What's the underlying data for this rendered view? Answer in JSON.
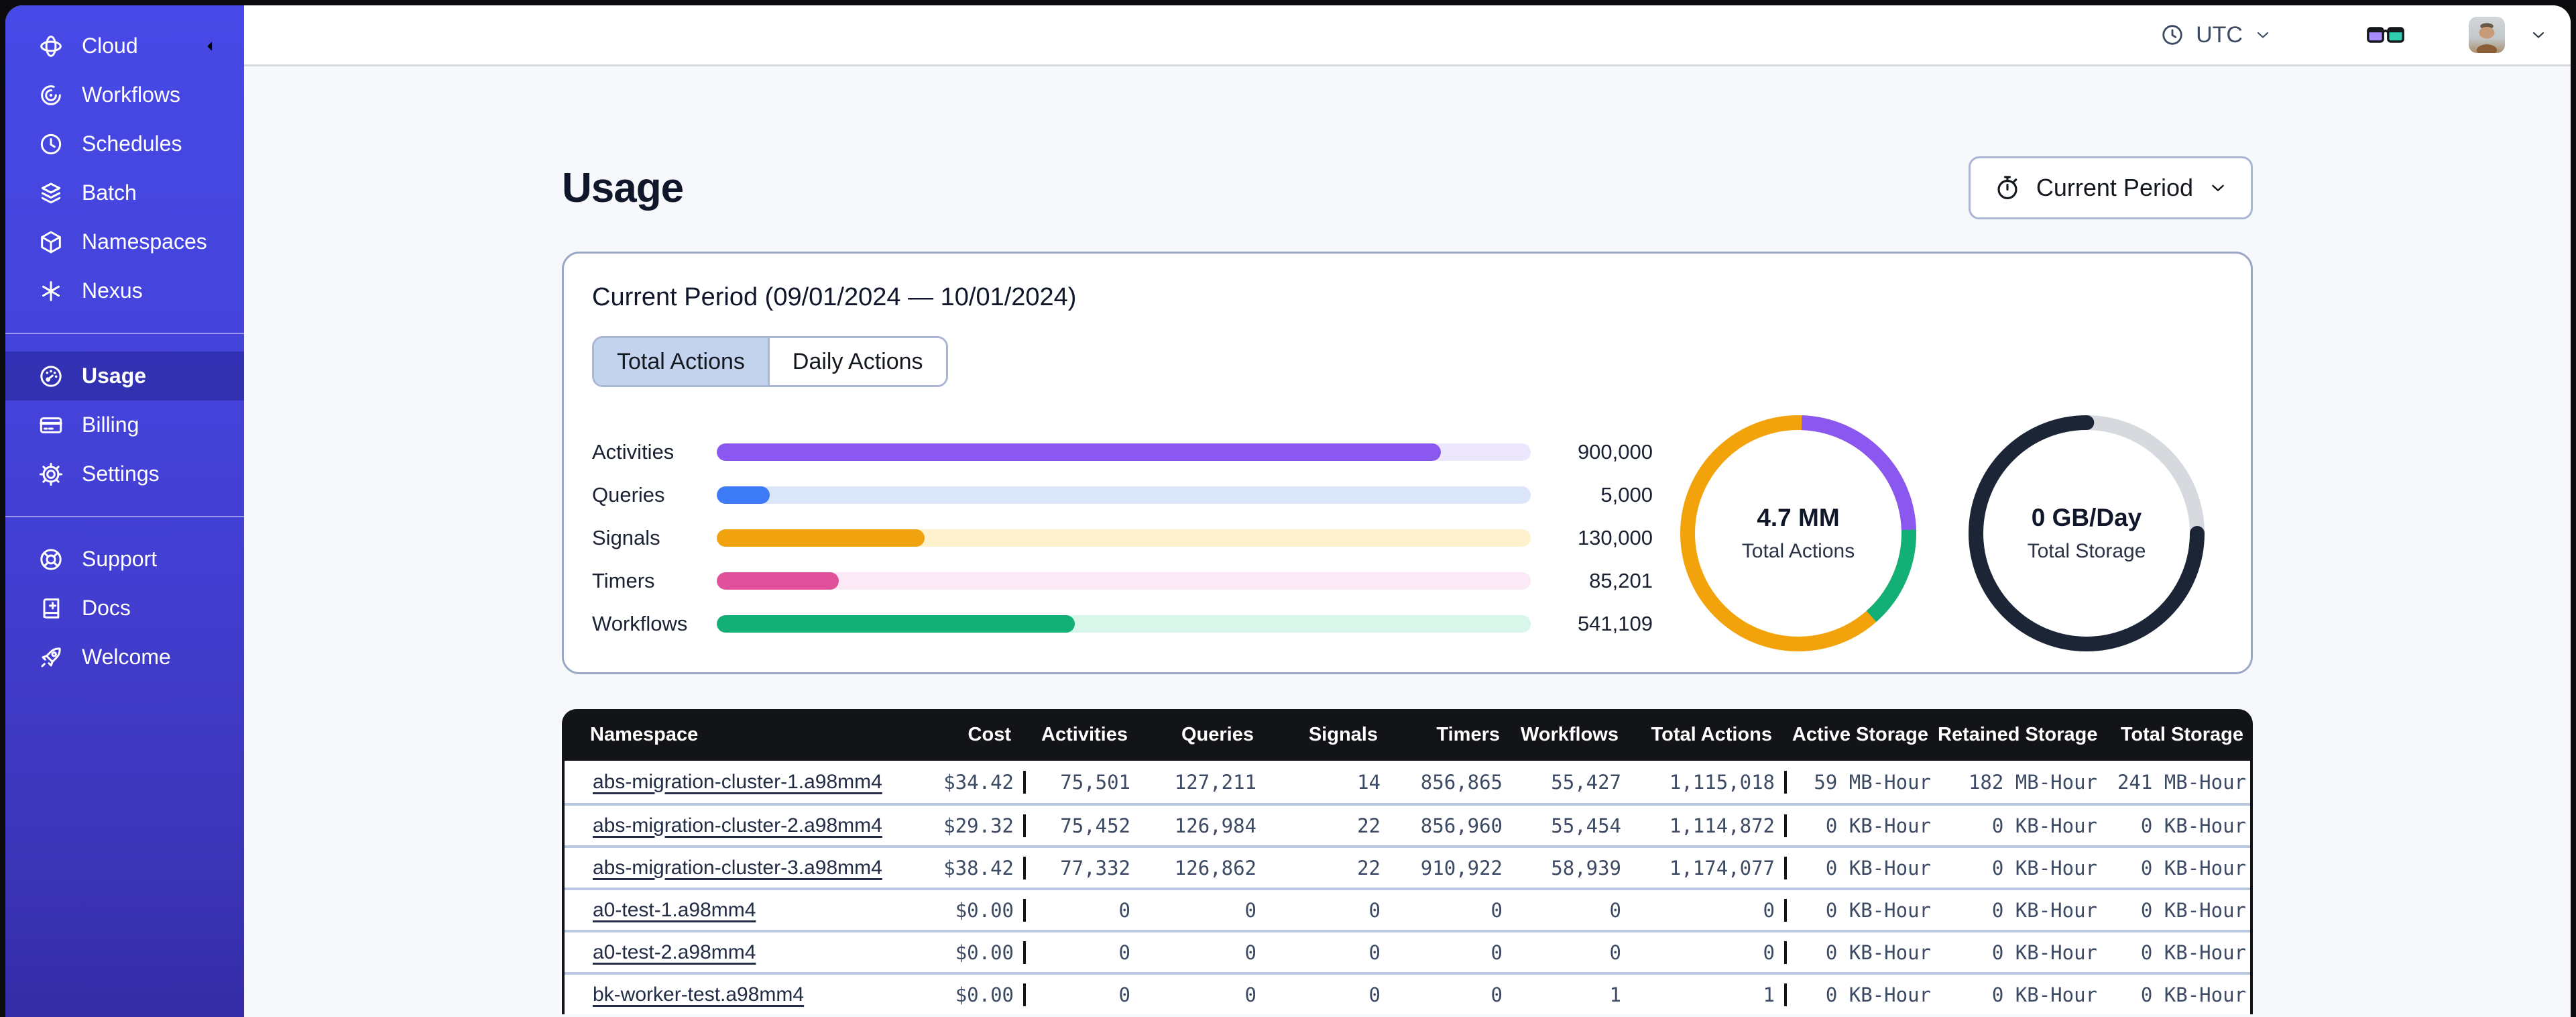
{
  "sidebar": {
    "brand": {
      "label": "Cloud",
      "icon": "temporal-logo-icon"
    },
    "groups": [
      {
        "items": [
          {
            "label": "Workflows",
            "icon": "workflows-icon"
          },
          {
            "label": "Schedules",
            "icon": "schedules-icon"
          },
          {
            "label": "Batch",
            "icon": "batch-icon"
          },
          {
            "label": "Namespaces",
            "icon": "namespaces-icon"
          },
          {
            "label": "Nexus",
            "icon": "nexus-icon"
          }
        ]
      },
      {
        "items": [
          {
            "label": "Usage",
            "icon": "usage-gauge-icon",
            "active": true
          },
          {
            "label": "Billing",
            "icon": "billing-card-icon"
          },
          {
            "label": "Settings",
            "icon": "settings-gear-icon"
          }
        ]
      },
      {
        "items": [
          {
            "label": "Support",
            "icon": "support-lifebuoy-icon"
          },
          {
            "label": "Docs",
            "icon": "docs-book-icon"
          },
          {
            "label": "Welcome",
            "icon": "welcome-rocket-icon"
          }
        ]
      }
    ]
  },
  "topbar": {
    "timezone": "UTC"
  },
  "main": {
    "title": "Usage",
    "period_button": "Current Period"
  },
  "usage_card": {
    "title": "Current Period (09/01/2024 — 10/01/2024)",
    "tabs": [
      {
        "label": "Total Actions",
        "active": true
      },
      {
        "label": "Daily Actions",
        "active": false
      }
    ],
    "bars": [
      {
        "label": "Activities",
        "value": "900,000",
        "percent": 89,
        "color": "#8a57f0",
        "track_color": "#ece7fc"
      },
      {
        "label": "Queries",
        "value": "5,000",
        "percent": 6.5,
        "color": "#3d7af5",
        "track_color": "#dbe6fb"
      },
      {
        "label": "Signals",
        "value": "130,000",
        "percent": 25.5,
        "color": "#f0a30e",
        "track_color": "#fdf2cd"
      },
      {
        "label": "Timers",
        "value": "85,201",
        "percent": 15,
        "color": "#e0509b",
        "track_color": "#fce9f6"
      },
      {
        "label": "Workflows",
        "value": "541,109",
        "percent": 44,
        "color": "#12b076",
        "track_color": "#d8f6e9"
      }
    ],
    "donuts": [
      {
        "value": "4.7 MM",
        "label": "Total Actions",
        "base_color": "#f2a30b",
        "start_percent": 0.5,
        "rounded": false,
        "segments": [
          {
            "color": "#8a57f0",
            "percent": 24
          },
          {
            "color": "#12b076",
            "percent": 14
          }
        ]
      },
      {
        "value": "0 GB/Day",
        "label": "Total Storage",
        "base_color": "#d6d9de",
        "start_percent": 25,
        "rounded": true,
        "segments": [
          {
            "color": "#1b2536",
            "percent": 75
          }
        ]
      }
    ]
  },
  "table": {
    "columns": [
      "Namespace",
      "Cost",
      "Activities",
      "Queries",
      "Signals",
      "Timers",
      "Workflows",
      "Total Actions",
      "Active Storage",
      "Retained Storage",
      "Total Storage"
    ],
    "rows": [
      {
        "cells": [
          "abs-migration-cluster-1.a98mm4",
          "$34.42",
          "75,501",
          "127,211",
          "14",
          "856,865",
          "55,427",
          "1,115,018",
          "59 MB-Hour",
          "182 MB-Hour",
          "241 MB-Hour"
        ]
      },
      {
        "cells": [
          "abs-migration-cluster-2.a98mm4",
          "$29.32",
          "75,452",
          "126,984",
          "22",
          "856,960",
          "55,454",
          "1,114,872",
          "0 KB-Hour",
          "0 KB-Hour",
          "0 KB-Hour"
        ]
      },
      {
        "cells": [
          "abs-migration-cluster-3.a98mm4",
          "$38.42",
          "77,332",
          "126,862",
          "22",
          "910,922",
          "58,939",
          "1,174,077",
          "0 KB-Hour",
          "0 KB-Hour",
          "0 KB-Hour"
        ]
      },
      {
        "cells": [
          "a0-test-1.a98mm4",
          "$0.00",
          "0",
          "0",
          "0",
          "0",
          "0",
          "0",
          "0 KB-Hour",
          "0 KB-Hour",
          "0 KB-Hour"
        ]
      },
      {
        "cells": [
          "a0-test-2.a98mm4",
          "$0.00",
          "0",
          "0",
          "0",
          "0",
          "0",
          "0",
          "0 KB-Hour",
          "0 KB-Hour",
          "0 KB-Hour"
        ]
      },
      {
        "cells": [
          "bk-worker-test.a98mm4",
          "$0.00",
          "0",
          "0",
          "0",
          "0",
          "1",
          "1",
          "0 KB-Hour",
          "0 KB-Hour",
          "0 KB-Hour"
        ]
      }
    ]
  },
  "colors": {
    "sidebar_top": "#4749e6",
    "sidebar_bottom": "#342ca6",
    "sidebar_active_bg": "rgba(10,10,90,0.30)",
    "card_border": "#9aa8c6",
    "tab_active_bg": "#c3d3ee",
    "table_header_bg": "#131417",
    "row_divider": "#b9c8de",
    "table_text": "#3d4a63",
    "content_bg": "#f7f8fb",
    "glasses_left_lens": "#a78bfa",
    "glasses_right_lens": "#2fd0b2"
  }
}
